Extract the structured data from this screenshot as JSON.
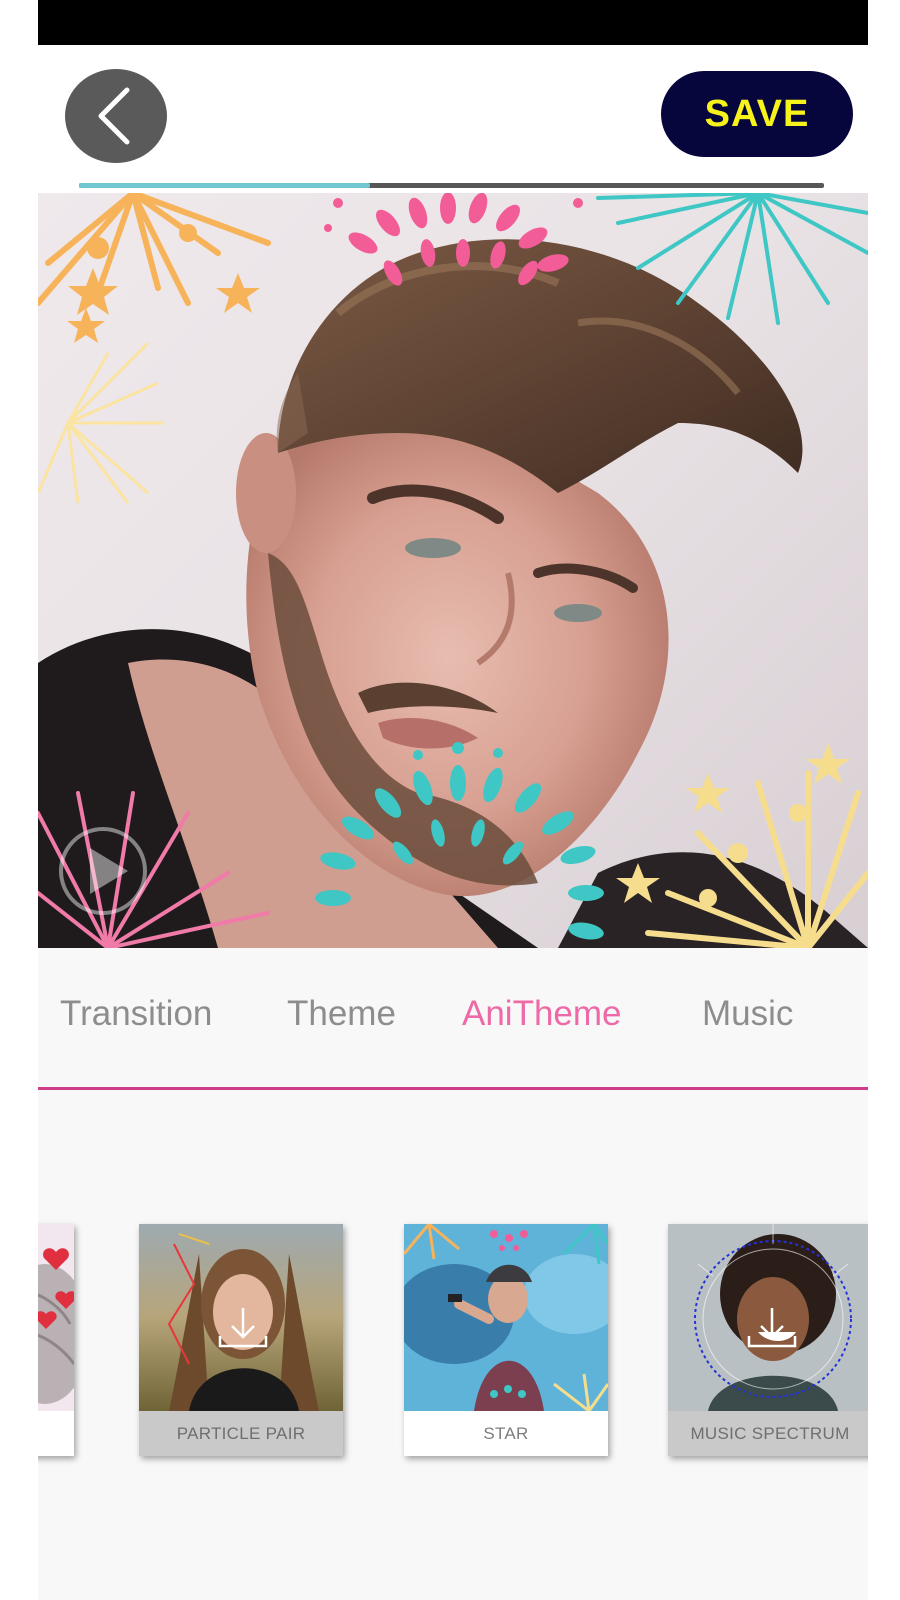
{
  "top_bar": {
    "back_icon": "chevron-left-icon",
    "save_label": "SAVE",
    "colors": {
      "back_bg": "#5a5a5a",
      "save_bg": "#06063d",
      "save_text": "#f6f21a"
    }
  },
  "playback": {
    "progress": 0.39,
    "progress_color": "#6fc7d2",
    "play_icon": "play-icon"
  },
  "tabs": [
    {
      "label": "Transition",
      "active": false
    },
    {
      "label": "Theme",
      "active": false
    },
    {
      "label": "AniTheme",
      "active": true
    },
    {
      "label": "Music",
      "active": false
    }
  ],
  "accent_color": "#ee6aa7",
  "themes": [
    {
      "label": "",
      "downloadable": false
    },
    {
      "label": "PARTICLE PAIR",
      "downloadable": true
    },
    {
      "label": "STAR",
      "downloadable": false
    },
    {
      "label": "MUSIC SPECTRUM",
      "downloadable": true
    }
  ]
}
